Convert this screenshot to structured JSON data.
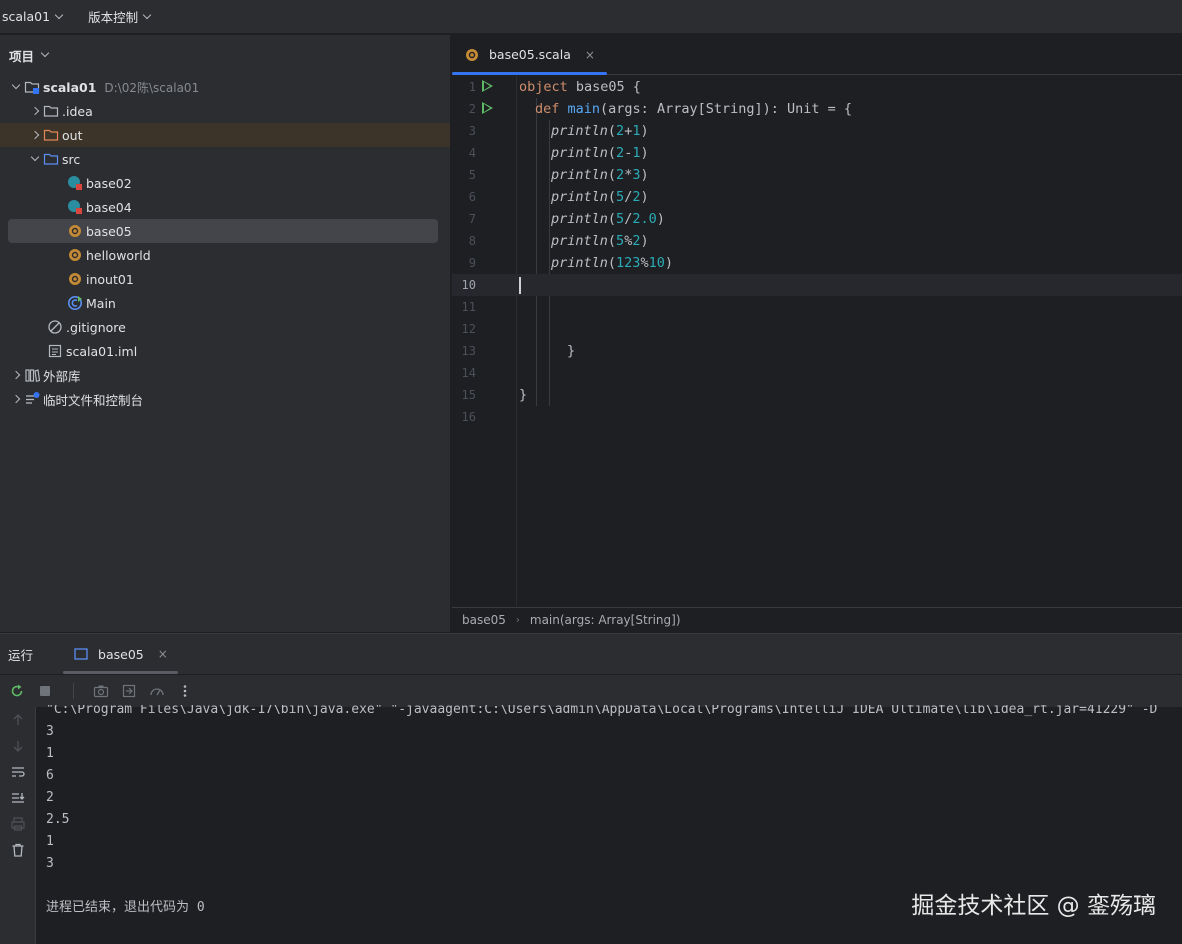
{
  "topbar": {
    "project_name": "scala01",
    "vcs_label": "版本控制"
  },
  "project_panel": {
    "title": "项目",
    "tree": {
      "root": {
        "name": "scala01",
        "path": "D:\\02陈\\scala01"
      },
      "idea": ".idea",
      "out": "out",
      "src": "src",
      "files": [
        "base02",
        "base04",
        "base05",
        "helloworld",
        "inout01",
        "Main"
      ],
      "gitignore": ".gitignore",
      "iml": "scala01.iml",
      "external_libs": "外部库",
      "scratches": "临时文件和控制台"
    }
  },
  "editor": {
    "tab_label": "base05.scala",
    "close_glyph": "×",
    "line_numbers": [
      "1",
      "2",
      "3",
      "4",
      "5",
      "6",
      "7",
      "8",
      "9",
      "10",
      "11",
      "12",
      "13",
      "14",
      "15",
      "16"
    ],
    "code": {
      "l1_kw": "object",
      "l1_rest": " base05 {",
      "l2_kw": "def",
      "l2_fn": "main",
      "l2_rest": "(args: Array[String]): Unit = {",
      "println": "println",
      "l3": [
        "(",
        "2",
        "+",
        "1",
        ")"
      ],
      "l4": [
        "(",
        "2",
        "-",
        "1",
        ")"
      ],
      "l5": [
        "(",
        "2",
        "*",
        "3",
        ")"
      ],
      "l6": [
        "(",
        "5",
        "/",
        "2",
        ")"
      ],
      "l7": [
        "(",
        "5",
        "/",
        "2.0",
        ")"
      ],
      "l8": [
        "(",
        "5",
        "%",
        "2",
        ")"
      ],
      "l9": [
        "(",
        "123",
        "%",
        "10",
        ")"
      ],
      "l13": "}",
      "l15": "}"
    },
    "breadcrumb": [
      "base05",
      "main(args: Array[String])"
    ]
  },
  "run_panel": {
    "title": "运行",
    "tab_label": "base05",
    "close_glyph": "×",
    "command": "\"C:\\Program Files\\Java\\jdk-17\\bin\\java.exe\" \"-javaagent:C:\\Users\\admin\\AppData\\Local\\Programs\\IntelliJ IDEA Ultimate\\lib\\idea_rt.jar=41229\" -D",
    "output": [
      "3",
      "1",
      "6",
      "2",
      "2.5",
      "1",
      "3"
    ],
    "exit_message": "进程已结束，退出代码为 0"
  },
  "watermark": "掘金技术社区 @ 銮殇璃",
  "colors": {
    "accent": "#3574f0",
    "keyword": "#cf8e6d",
    "function": "#56a8f5",
    "number": "#2aacb8",
    "run_green": "#5fb865"
  }
}
